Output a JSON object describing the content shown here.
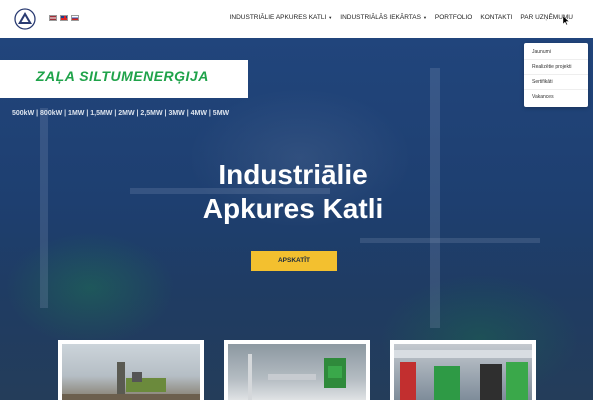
{
  "header": {
    "languages": [
      "LV",
      "EN",
      "RU"
    ],
    "nav": [
      {
        "label": "INDUSTRIĀLIE APKURES KATLI",
        "has_caret": true
      },
      {
        "label": "INDUSTRIĀLĀS IEKĀRTAS",
        "has_caret": true
      },
      {
        "label": "PORTFOLIO",
        "has_caret": false
      },
      {
        "label": "KONTAKTI",
        "has_caret": false
      },
      {
        "label": "PAR UZŅĒMUMU",
        "has_caret": false
      }
    ],
    "dropdown": [
      "Jaunumi",
      "Realizētie projekti",
      "Sertifikāti",
      "Vakances"
    ]
  },
  "hero": {
    "brand": "ZAĻA SILTUMENERĢIJA",
    "power_line": "500kW | 800kW | 1MW | 1,5MW | 2MW | 2,5MW | 3MW | 4MW | 5MW",
    "title_line1": "Industriālie",
    "title_line2": "Apkures Katli",
    "cta": "APSKATĪT"
  },
  "colors": {
    "hero_overlay": "#1e3f70",
    "cta": "#f3c02f",
    "brand_green": "#1fa34a"
  }
}
